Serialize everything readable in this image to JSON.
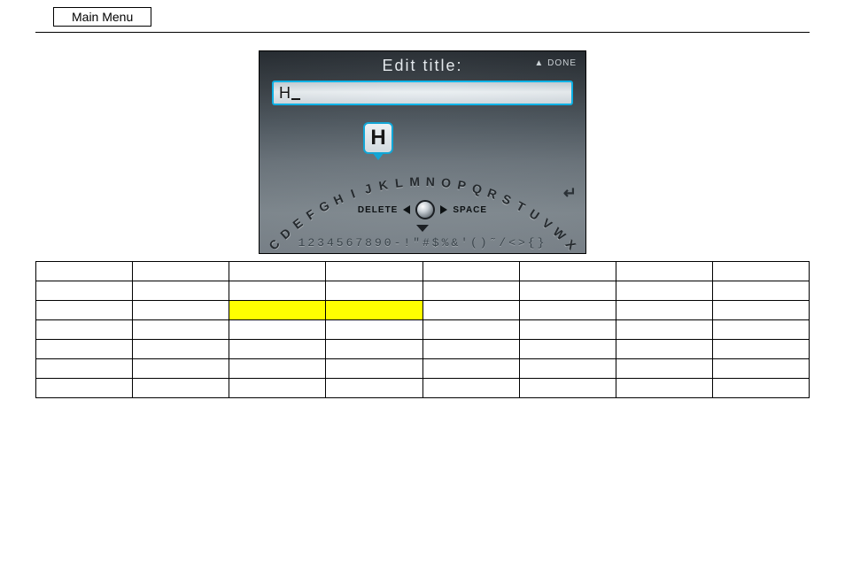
{
  "header": {
    "main_menu_label": "Main Menu"
  },
  "device": {
    "title": "Edit title:",
    "done_label": "DONE",
    "input_value": "H",
    "selected_char": "H",
    "delete_label": "DELETE",
    "space_label": "SPACE",
    "alphabet": "ABCDEFGHIJKLMNOPQRSTUVWXYZ",
    "symbols_row": "1234567890-!\"#$%&'()˜/<>{}"
  },
  "table": {
    "headers": [
      "",
      "",
      "",
      "",
      "",
      "",
      "",
      ""
    ],
    "rows": [
      [
        "",
        "",
        "",
        "",
        "",
        "",
        "",
        ""
      ],
      [
        "",
        "",
        {
          "text": "",
          "hl": true
        },
        {
          "text": "",
          "hl": true
        },
        "",
        "",
        "",
        ""
      ],
      [
        "",
        "",
        "",
        "",
        "",
        "",
        "",
        ""
      ],
      [
        "",
        "",
        "",
        "",
        "",
        "",
        "",
        ""
      ],
      [
        "",
        "",
        "",
        "",
        "",
        "",
        "",
        ""
      ],
      [
        "",
        "",
        "",
        "",
        "",
        "",
        "",
        ""
      ]
    ]
  }
}
